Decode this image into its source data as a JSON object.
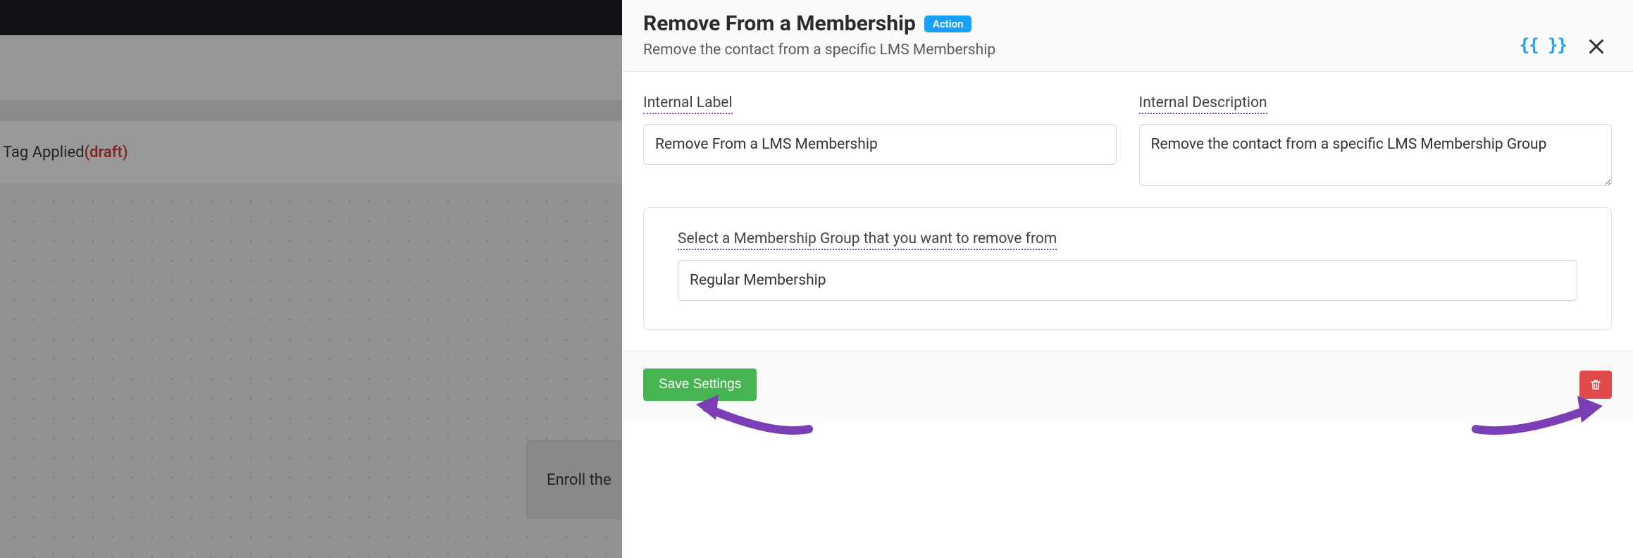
{
  "background": {
    "title_prefix": "Tag Applied ",
    "title_status": "(draft)",
    "node_text": "Enroll the"
  },
  "panel": {
    "title": "Remove From a Membership",
    "badge": "Action",
    "subtitle": "Remove the contact from a specific LMS Membership",
    "braces": "{{ }}",
    "fields": {
      "internal_label": {
        "label": "Internal Label",
        "value": "Remove From a LMS Membership"
      },
      "internal_description": {
        "label": "Internal Description",
        "value": "Remove the contact from a specific LMS Membership Group"
      }
    },
    "group": {
      "label": "Select a Membership Group that you want to remove from",
      "selected": "Regular Membership"
    },
    "footer": {
      "save_label": "Save Settings"
    }
  }
}
